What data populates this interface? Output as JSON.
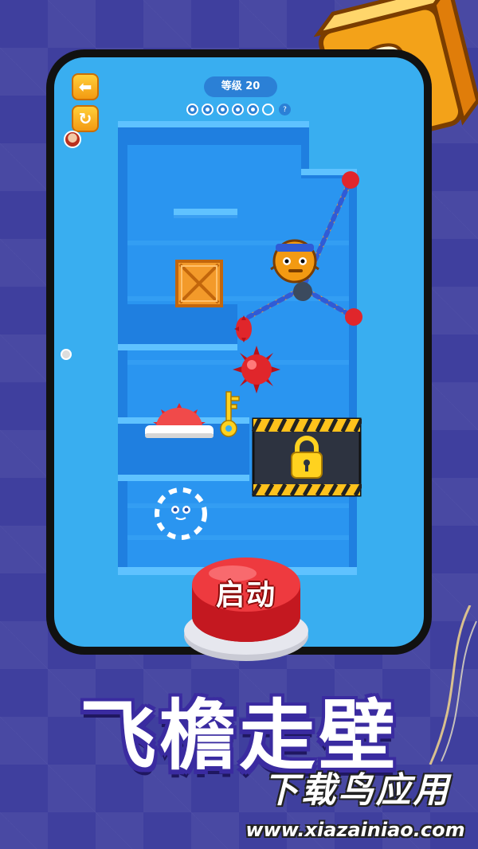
{
  "hud": {
    "back_icon": "arrow-left-icon",
    "restart_icon": "restart-icon",
    "level_label": "等级 20",
    "hint_label": "?",
    "progress": {
      "completed": 5,
      "total": 6
    }
  },
  "game": {
    "start_button_label": "启动",
    "objects": [
      "rope-hero",
      "wooden-crate",
      "spiked-ball",
      "saw-blade",
      "golden-key",
      "locked-chest",
      "portal-exit"
    ]
  },
  "promo": {
    "title": "飞檐走壁",
    "watermark_title": "下载鸟应用",
    "watermark_url": "www.xiazainiao.com"
  },
  "colors": {
    "screen_bg": "#39aef0",
    "maze_wall": "#1f7fe0",
    "maze_floor": "#2a95f0",
    "accent_orange": "#f39a12",
    "start_red": "#e0262b",
    "title_purple": "#3a2ba0"
  }
}
